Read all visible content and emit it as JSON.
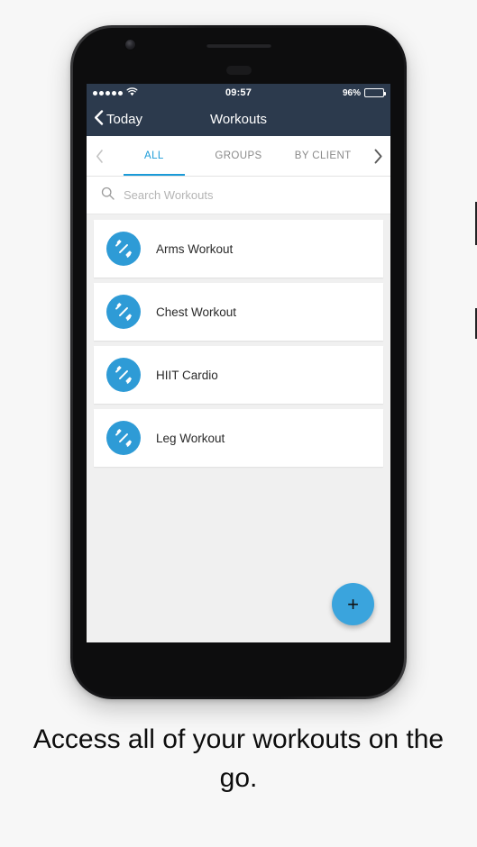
{
  "device": {
    "name": "smartphone-mockup",
    "hardware": {
      "earpiece": "earpiece-speaker",
      "camera": "front-camera",
      "sensor": "proximity-sensor",
      "power_button": "power-button",
      "volume_button": "volume-rocker"
    }
  },
  "status_bar": {
    "signal_dots": 5,
    "wifi_icon": "wifi-icon",
    "time": "09:57",
    "battery_percent": "96%",
    "battery_level": 96,
    "background_color": "#2c3a4d"
  },
  "nav_bar": {
    "back_icon": "chevron-left-icon",
    "back_label": "Today",
    "title": "Workouts",
    "background_color": "#2c3a4d"
  },
  "tabs": {
    "prev_arrow_icon": "chevron-left-icon",
    "next_arrow_icon": "chevron-right-icon",
    "active_index": 0,
    "accent_color": "#1b9bd8",
    "items": [
      {
        "label": "ALL"
      },
      {
        "label": "GROUPS"
      },
      {
        "label": "BY CLIENT"
      }
    ]
  },
  "search": {
    "icon": "search-icon",
    "placeholder": "Search Workouts",
    "value": ""
  },
  "workouts": {
    "icon": "dumbbell-icon",
    "icon_color": "#2e9bd6",
    "items": [
      {
        "label": "Arms Workout"
      },
      {
        "label": "Chest Workout"
      },
      {
        "label": "HIIT Cardio"
      },
      {
        "label": "Leg Workout"
      }
    ]
  },
  "fab": {
    "icon": "plus-icon",
    "label": "+",
    "color": "#3aa4dd"
  },
  "caption": {
    "text": "Access all of your workouts on the go."
  }
}
